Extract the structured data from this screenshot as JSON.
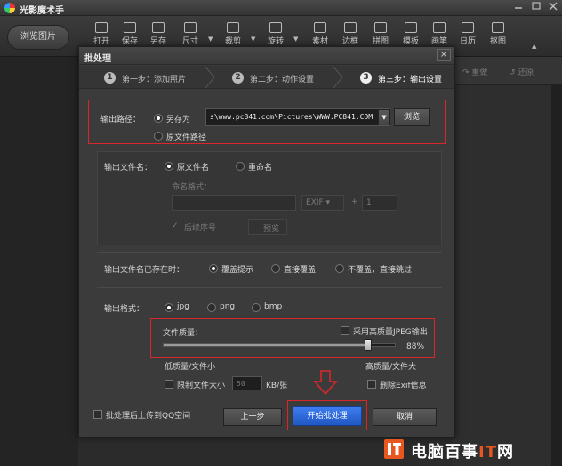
{
  "app": {
    "title": "光影魔术手"
  },
  "toolbar": {
    "browse_label": "浏览图片",
    "tools": [
      {
        "label": "打开",
        "icon": "open-icon"
      },
      {
        "label": "保存",
        "icon": "save-icon"
      },
      {
        "label": "另存",
        "icon": "save-as-icon"
      },
      {
        "label": "尺寸",
        "icon": "resize-icon"
      },
      {
        "label": "裁剪",
        "icon": "crop-icon"
      },
      {
        "label": "旋转",
        "icon": "rotate-icon"
      },
      {
        "label": "素材",
        "icon": "material-icon"
      },
      {
        "label": "边框",
        "icon": "frame-icon"
      },
      {
        "label": "拼图",
        "icon": "collage-icon"
      },
      {
        "label": "模板",
        "icon": "template-icon"
      },
      {
        "label": "画笔",
        "icon": "brush-icon"
      },
      {
        "label": "日历",
        "icon": "calendar-icon"
      },
      {
        "label": "抠图",
        "icon": "cutout-icon"
      }
    ]
  },
  "right_panel": {
    "redo": "重做",
    "restore": "还原"
  },
  "dialog": {
    "title": "批处理",
    "close": "×",
    "steps": [
      {
        "num": "1",
        "label": "第一步：添加照片"
      },
      {
        "num": "2",
        "label": "第二步：动作设置"
      },
      {
        "num": "3",
        "label": "第三步：输出设置"
      }
    ],
    "output_path": {
      "label": "输出路径：",
      "save_as": "另存为",
      "path_value": "s\\www.pc841.com\\Pictures\\WWW.PC841.COM",
      "browse": "浏览",
      "original_path": "原文件路径"
    },
    "output_name": {
      "label": "输出文件名：",
      "original_name": "原文件名",
      "rename": "重命名",
      "naming_format": "命名格式：",
      "ext": "EXIF",
      "plus": "+",
      "number": "1",
      "post_sequence": "后续序号",
      "preview": "预览"
    },
    "exists": {
      "label": "输出文件名已存在时：",
      "opt1": "覆盖提示",
      "opt2": "直接覆盖",
      "opt3": "不覆盖，直接跳过"
    },
    "format": {
      "label": "输出格式：",
      "jpg": "jpg",
      "png": "png",
      "bmp": "bmp"
    },
    "quality": {
      "label": "文件质量：",
      "high_jpeg": "采用高质量JPEG输出",
      "value": 88,
      "value_text": "88%",
      "low_label": "低质量/文件小",
      "high_label": "高质量/文件大",
      "limit_size": "限制文件大小",
      "limit_value": "50",
      "limit_unit": "KB/张",
      "delete_exif": "删除Exif信息"
    },
    "footer": {
      "upload_qq": "批处理后上传到QQ空间",
      "prev": "上一步",
      "start": "开始批处理",
      "cancel": "取消"
    }
  },
  "watermark": {
    "prefix": "电脑百事",
    "it": "IT",
    "suffix": "网",
    "full": "电脑百事IT网"
  },
  "colors": {
    "highlight": "#d9262a",
    "dialog_bg": "#3b3b3b",
    "accent_blue": "#2f6bd8"
  }
}
